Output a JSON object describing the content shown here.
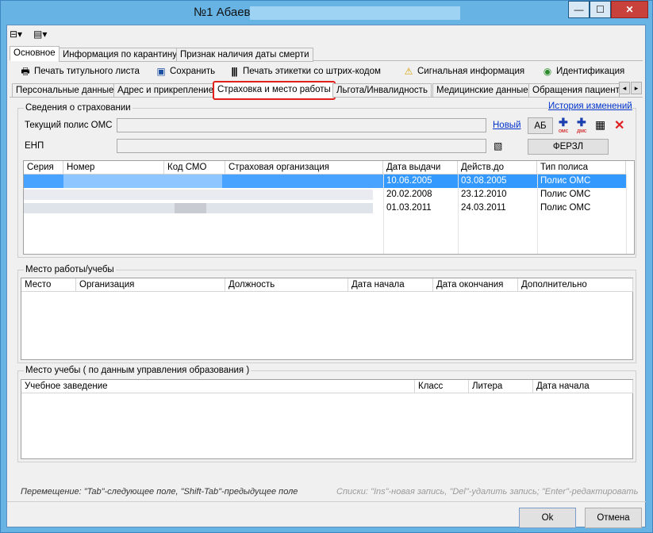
{
  "window": {
    "title": "№1 Абаев",
    "minimize_glyph": "—",
    "maximize_glyph": "☐",
    "close_glyph": "✕"
  },
  "main_tabs": [
    "Основное",
    "Информация по карантину",
    "Признак наличия даты смерти"
  ],
  "toolbar": {
    "print_title": "Печать титульного листа",
    "save": "Сохранить",
    "print_barcode": "Печать этикетки со штрих-кодом",
    "signal_info": "Сигнальная информация",
    "identification": "Идентификация"
  },
  "sub_tabs": [
    "Персональные данные",
    "Адрес и прикрепление",
    "Страховка и место работы",
    "Льгота/Инвалидность",
    "Медицинские данные",
    "Обращения пациента"
  ],
  "insurance": {
    "group_label": "Сведения о страховании",
    "history_link": "История изменений",
    "current_policy_label": "Текущий полис ОМС",
    "new_link": "Новый",
    "ab_button": "АБ",
    "enp_label": "ЕНП",
    "ferzl_button": "ФЕРЗЛ",
    "columns": [
      "Серия",
      "Номер",
      "Код СМО",
      "Страховая организация",
      "Дата выдачи",
      "Действ.до",
      "Тип полиса"
    ],
    "rows": [
      {
        "issue_date": "10.06.2005",
        "valid_to": "03.08.2005",
        "type": "Полис ОМС"
      },
      {
        "issue_date": "20.02.2008",
        "valid_to": "23.12.2010",
        "type": "Полис ОМС"
      },
      {
        "issue_date": "01.03.2011",
        "valid_to": "24.03.2011",
        "type": "Полис ОМС"
      }
    ]
  },
  "work": {
    "group_label": "Место работы/учебы",
    "columns": [
      "Место",
      "Организация",
      "Должность",
      "Дата начала",
      "Дата окончания",
      "Дополнительно"
    ]
  },
  "study": {
    "group_label": "Место учебы ( по данным управления образования )",
    "columns": [
      "Учебное заведение",
      "Класс",
      "Литера",
      "Дата начала"
    ]
  },
  "hints": {
    "navigation": "Перемещение: \"Tab\"-следующее поле, \"Shift-Tab\"-предыдущее поле",
    "lists": "Списки: \"Ins\"-новая запись, \"Del\"-удалить запись; \"Enter\"-редактировать"
  },
  "footer": {
    "ok": "Ok",
    "cancel": "Отмена"
  },
  "colors": {
    "accent": "#67b4e4",
    "selection": "#3399ff",
    "highlight_tab_border": "#e0201a",
    "link": "#0033cc"
  }
}
